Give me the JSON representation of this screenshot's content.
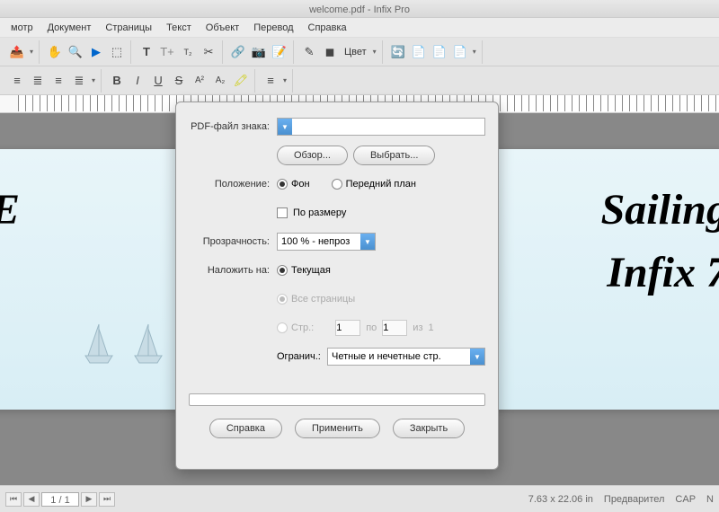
{
  "title": "welcome.pdf - Infix Pro",
  "menu": [
    "мотр",
    "Документ",
    "Страницы",
    "Текст",
    "Объект",
    "Перевод",
    "Справка"
  ],
  "toolbar": {
    "color_label": "Цвет"
  },
  "canvas": {
    "text_left": "E",
    "text_sailing": "Sailing",
    "text_infix": "Infix 7"
  },
  "dialog": {
    "pdf_file_label": "PDF-файл знака:",
    "browse": "Обзор...",
    "select": "Выбрать...",
    "position_label": "Положение:",
    "background": "Фон",
    "foreground": "Передний план",
    "fit_size": "По размеру",
    "opacity_label": "Прозрачность:",
    "opacity_value": "100 % - непроз",
    "apply_to_label": "Наложить на:",
    "current": "Текущая",
    "all_pages": "Все страницы",
    "pages_radio": "Стр.:",
    "pages_from": "1",
    "to_label": "по",
    "pages_to": "1",
    "of_label": "из",
    "total": "1",
    "limit_label": "Огранич.:",
    "limit_value": "Четные и нечетные стр.",
    "help": "Справка",
    "apply": "Применить",
    "close": "Закрыть"
  },
  "status": {
    "page": "1 / 1",
    "dims": "7.63 x 22.06 in",
    "preview": "Предварител",
    "cap": "CAP",
    "n": "N"
  }
}
